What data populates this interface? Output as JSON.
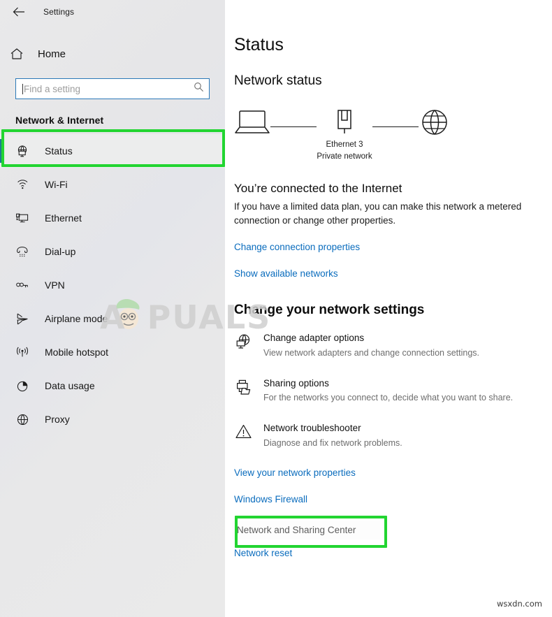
{
  "window": {
    "title": "Settings",
    "back_icon": "back-arrow-icon"
  },
  "sidebar": {
    "home": {
      "label": "Home",
      "icon": "home-icon"
    },
    "search": {
      "value": "",
      "placeholder": "Find a setting",
      "icon": "search-icon"
    },
    "section_title": "Network & Internet",
    "items": [
      {
        "label": "Status",
        "icon": "status-globe-monitor-icon",
        "selected": true
      },
      {
        "label": "Wi-Fi",
        "icon": "wifi-icon",
        "selected": false
      },
      {
        "label": "Ethernet",
        "icon": "ethernet-icon",
        "selected": false
      },
      {
        "label": "Dial-up",
        "icon": "dialup-phone-icon",
        "selected": false
      },
      {
        "label": "VPN",
        "icon": "vpn-key-icon",
        "selected": false
      },
      {
        "label": "Airplane mode",
        "icon": "airplane-icon",
        "selected": false
      },
      {
        "label": "Mobile hotspot",
        "icon": "hotspot-signal-icon",
        "selected": false
      },
      {
        "label": "Data usage",
        "icon": "pie-chart-icon",
        "selected": false
      },
      {
        "label": "Proxy",
        "icon": "globe-icon",
        "selected": false
      }
    ]
  },
  "main": {
    "page_title": "Status",
    "network_status_heading": "Network status",
    "diagram": {
      "device_icon": "laptop-icon",
      "adapter_icon": "ethernet-port-icon",
      "internet_icon": "globe-icon",
      "adapter_name": "Ethernet 3",
      "adapter_type": "Private network"
    },
    "connected_heading": "You’re connected to the Internet",
    "connected_body": "If you have a limited data plan, you can make this network a metered connection or change other properties.",
    "top_links": [
      {
        "label": "Change connection properties"
      },
      {
        "label": "Show available networks"
      }
    ],
    "change_settings_heading": "Change your network settings",
    "options": [
      {
        "icon": "adapter-globe-monitor-icon",
        "title": "Change adapter options",
        "desc": "View network adapters and change connection settings."
      },
      {
        "icon": "sharing-printer-folder-icon",
        "title": "Sharing options",
        "desc": "For the networks you connect to, decide what you want to share."
      },
      {
        "icon": "warning-triangle-icon",
        "title": "Network troubleshooter",
        "desc": "Diagnose and fix network problems."
      }
    ],
    "bottom_links": [
      {
        "label": "View your network properties",
        "state": "normal"
      },
      {
        "label": "Windows Firewall",
        "state": "normal"
      },
      {
        "label": "Network and Sharing Center",
        "state": "hovered"
      },
      {
        "label": "Network reset",
        "state": "normal"
      }
    ]
  },
  "annotations": {
    "highlight_color": "#22d531",
    "boxes": [
      {
        "target": "sidebar-item-status"
      },
      {
        "target": "link-network-and-sharing-center"
      }
    ]
  },
  "watermarks": {
    "brand": "APPUALS",
    "corner": "wsxdn.com"
  },
  "colors": {
    "accent_blue": "#0a6cbd",
    "selection_bar": "#1a7e8f",
    "search_border": "#2b79b8",
    "highlight_green": "#22d531"
  }
}
